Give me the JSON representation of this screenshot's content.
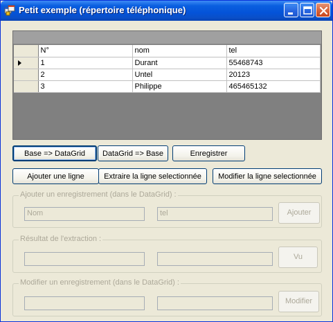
{
  "window": {
    "title": "Petit exemple  (répertoire téléphonique)"
  },
  "grid": {
    "columns": [
      "N°",
      "nom",
      "tel"
    ],
    "rows": [
      {
        "n": "1",
        "nom": "Durant",
        "tel": "55468743"
      },
      {
        "n": "2",
        "nom": "Untel",
        "tel": "20123"
      },
      {
        "n": "3",
        "nom": "Philippe",
        "tel": "465465132"
      }
    ]
  },
  "buttons": {
    "base_to_grid": "Base => DataGrid",
    "grid_to_base": "DataGrid => Base",
    "save": "Enregistrer",
    "add_line": "Ajouter une ligne",
    "extract_line": "Extraire la ligne selectionnée",
    "modify_line": "Modifier la ligne selectionnée"
  },
  "add_group": {
    "label": "Ajouter un enregistrement (dans le DataGrid) :",
    "nom_value": "Nom",
    "tel_value": "tel",
    "button": "Ajouter"
  },
  "extract_group": {
    "label": "Résultat de l'extraction :",
    "field1_value": "",
    "field2_value": "",
    "button": "Vu"
  },
  "modify_group": {
    "label": "Modifier un enregistrement (dans le DataGrid) :",
    "field1_value": "",
    "field2_value": "",
    "button": "Modifier"
  },
  "icons": {
    "app": "app-window-icon",
    "minimize": "minimize-icon",
    "maximize": "maximize-icon",
    "close": "close-icon",
    "current_row": "current-row-arrow-icon"
  }
}
